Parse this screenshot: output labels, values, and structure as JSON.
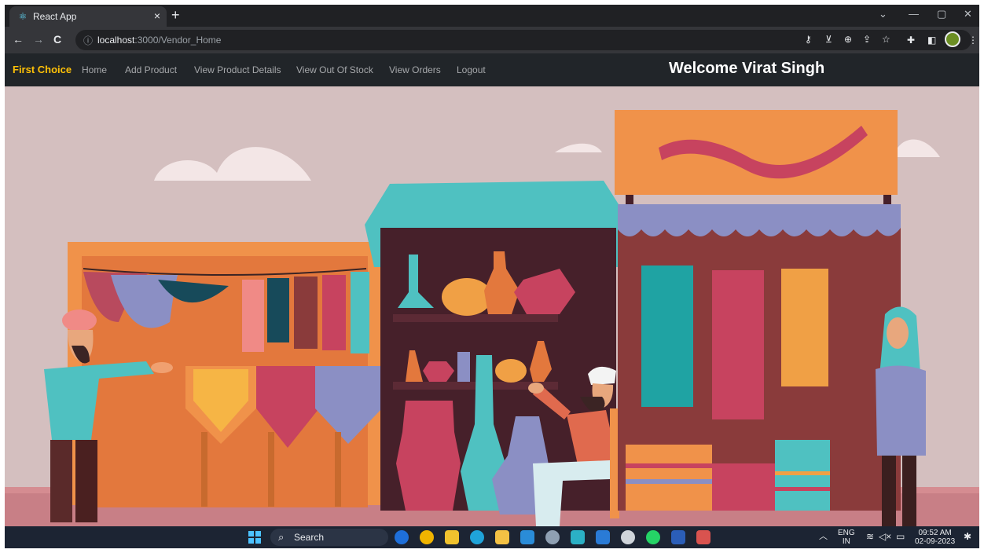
{
  "browser": {
    "tab_title": "React App",
    "tab_close": "×",
    "new_tab": "+",
    "window_controls": [
      "⌄",
      "—",
      "▢",
      "✕"
    ],
    "back": "←",
    "forward": "→",
    "reload": "C",
    "url_host": "localhost",
    "url_rest": ":3000/Vendor_Home",
    "toolbar_icons": [
      "key-icon",
      "install-icon",
      "zoom-icon",
      "share-icon",
      "star-icon",
      "extensions-icon",
      "sidepanel-icon",
      "profile-icon",
      "menu-icon"
    ]
  },
  "navbar": {
    "brand": "First Choice",
    "links": [
      "Home",
      "Add Product",
      "View Product Details",
      "View Out Of Stock",
      "View Orders",
      "Logout"
    ],
    "welcome": "Welcome Virat Singh",
    "brand_color": "#ffc107"
  },
  "hero": {
    "illustration": "market-bazaar-illustration"
  },
  "taskbar": {
    "search_label": "Search",
    "language_line1": "ENG",
    "language_line2": "IN",
    "time": "09:52 AM",
    "date": "02-09-2023",
    "apps": [
      "bing-icon",
      "chrome-icon",
      "store-icon",
      "edge-icon",
      "files-icon",
      "l-app-icon",
      "settings-icon",
      "monitor-icon",
      "vscode-icon",
      "gear-icon",
      "whatsapp-icon",
      "word-icon",
      "snip-icon"
    ]
  }
}
